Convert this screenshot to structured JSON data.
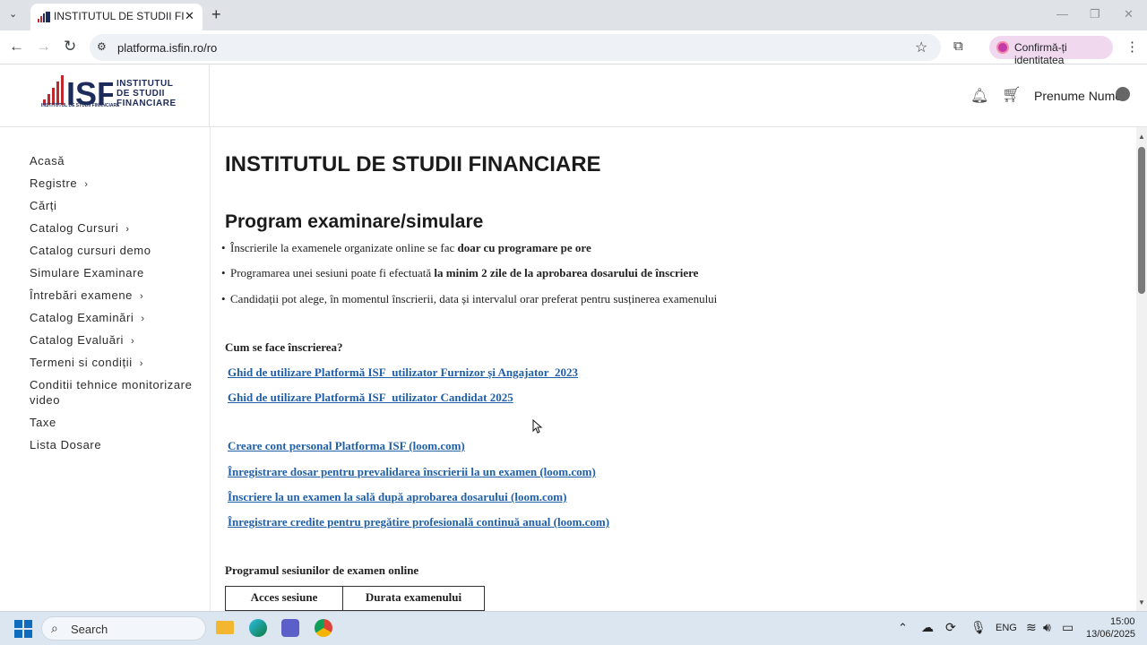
{
  "browser": {
    "tab_title": "INSTITUTUL DE STUDII FINANCIARE",
    "url": "platforma.isfin.ro/ro",
    "profile_label": "Confirmă-ți identitatea"
  },
  "site": {
    "brand_line1": "INSTITUTUL",
    "brand_line2": "DE STUDII",
    "brand_line3": "FINANCIARE",
    "logo_caption": "INSTITUTUL DE STUDII FINANCIARE",
    "user_name": "Prenume Nume"
  },
  "sidebar": {
    "items": [
      {
        "label": "Acasă",
        "has_chevron": false
      },
      {
        "label": "Registre",
        "has_chevron": true
      },
      {
        "label": "Cărți",
        "has_chevron": false
      },
      {
        "label": "Catalog Cursuri",
        "has_chevron": true
      },
      {
        "label": "Catalog cursuri demo",
        "has_chevron": false
      },
      {
        "label": "Simulare Examinare",
        "has_chevron": false
      },
      {
        "label": "Întrebări examene",
        "has_chevron": true
      },
      {
        "label": "Catalog Examinări",
        "has_chevron": true
      },
      {
        "label": "Catalog Evaluări",
        "has_chevron": true
      },
      {
        "label": "Termeni si condiții",
        "has_chevron": true
      },
      {
        "label": "Conditii tehnice monitorizare",
        "has_chevron": false
      },
      {
        "label": "video",
        "has_chevron": false
      },
      {
        "label": "Taxe",
        "has_chevron": false
      },
      {
        "label": "Lista Dosare",
        "has_chevron": false
      }
    ]
  },
  "main": {
    "title": "INSTITUTUL DE STUDII FINANCIARE",
    "section_title": "Program examinare/simulare",
    "bullets": [
      {
        "text": "Înscrierile la examenele organizate online se fac ",
        "bold": "doar cu programare pe ore"
      },
      {
        "text": "Programarea unei sesiuni poate fi efectuată ",
        "bold": "la minim 2 zile de la aprobarea dosarului de înscriere"
      },
      {
        "text": "Candidații pot alege, în momentul înscrierii, data și intervalul orar preferat pentru susținerea examenului",
        "bold": ""
      }
    ],
    "how_to_title": "Cum se face înscrierea?",
    "guide_links": [
      "Ghid de utilizare Platformă ISF_utilizator Furnizor și Angajator_2023",
      "Ghid de utilizare Platformă ISF_utilizator Candidat 2025"
    ],
    "video_links": [
      "Creare cont personal Platforma ISF (loom.com)",
      "Înregistrare dosar pentru prevalidarea înscrierii la un examen (loom.com)",
      "Înscriere la un examen la sală după aprobarea dosarului (loom.com)",
      "Înregistrare credite pentru pregătire profesională continuă anual (loom.com)"
    ],
    "schedule_title": "Programul sesiunilor de examen online",
    "table_headers": [
      "Acces sesiune",
      "Durata examenului"
    ]
  },
  "taskbar": {
    "search_label": "Search",
    "language": "ENG",
    "time": "15:00",
    "date": "13/06/2025"
  }
}
